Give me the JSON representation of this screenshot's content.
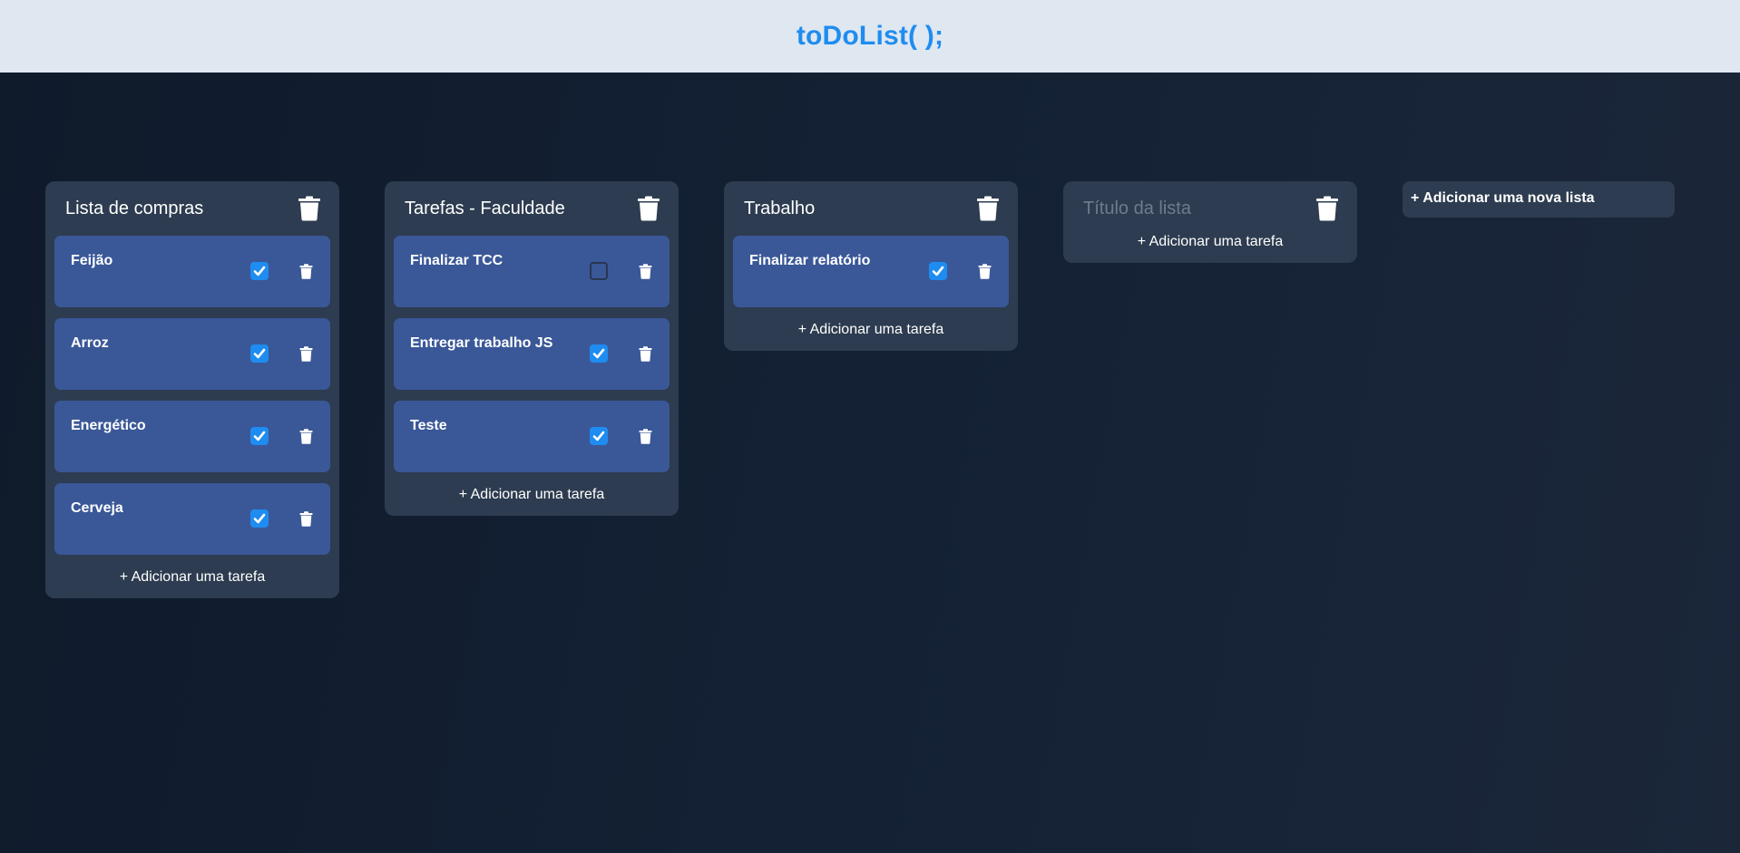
{
  "header": {
    "title": "toDoList( );"
  },
  "lists": [
    {
      "title": "Lista de compras",
      "tasks": [
        {
          "label": "Feijão",
          "done": true
        },
        {
          "label": "Arroz",
          "done": true
        },
        {
          "label": "Energético",
          "done": true
        },
        {
          "label": "Cerveja",
          "done": true
        }
      ],
      "add_task_label": "+ Adicionar uma tarefa"
    },
    {
      "title": "Tarefas - Faculdade",
      "tasks": [
        {
          "label": "Finalizar TCC",
          "done": false
        },
        {
          "label": "Entregar trabalho JS",
          "done": true
        },
        {
          "label": "Teste",
          "done": true
        }
      ],
      "add_task_label": "+ Adicionar uma tarefa"
    },
    {
      "title": "Trabalho",
      "tasks": [
        {
          "label": "Finalizar relatório",
          "done": true
        }
      ],
      "add_task_label": "+ Adicionar uma tarefa"
    },
    {
      "title_placeholder": "Título da lista",
      "tasks": [],
      "add_task_label": "+ Adicionar uma tarefa"
    }
  ],
  "new_list_label": "+ Adicionar uma nova lista",
  "icons": {
    "delete": "trash-icon",
    "check": "checkmark-icon"
  },
  "colors": {
    "accent": "#1f8cf0",
    "card": "#2d3c50",
    "task": "#3a5898",
    "header_bg": "#dfe7f0"
  }
}
